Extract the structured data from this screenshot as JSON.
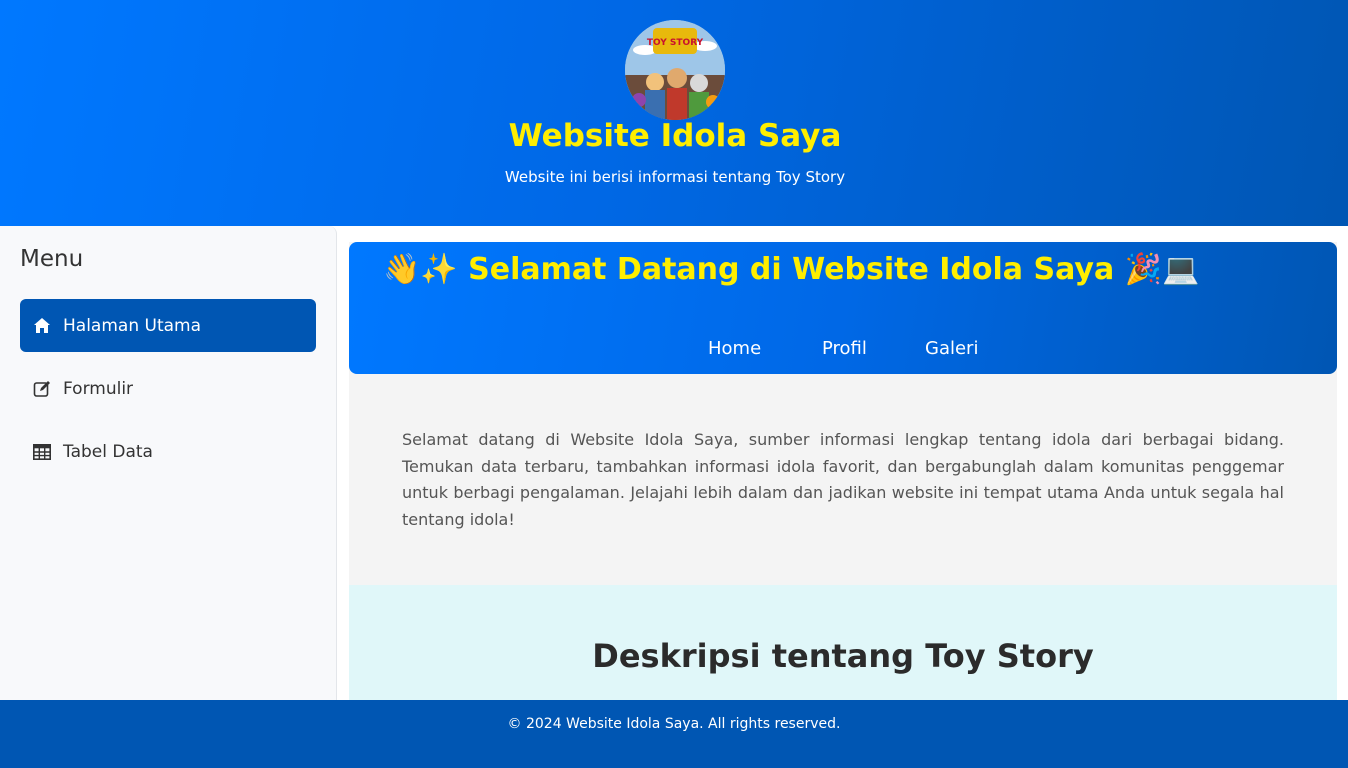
{
  "header": {
    "title": "Website Idola Saya",
    "subtitle": "Website ini berisi informasi tentang Toy Story",
    "avatar_icon": "toy-story-logo",
    "logo_text": "TOY STORY"
  },
  "sidebar": {
    "title": "Menu",
    "items": [
      {
        "label": "Halaman Utama",
        "icon": "home-icon",
        "active": true
      },
      {
        "label": "Formulir",
        "icon": "edit-icon",
        "active": false
      },
      {
        "label": "Tabel Data",
        "icon": "table-icon",
        "active": false
      }
    ]
  },
  "main": {
    "welcome_heading": "👋✨ Selamat Datang di Website Idola Saya 🎉💻",
    "nav": [
      {
        "label": "Home"
      },
      {
        "label": "Profil"
      },
      {
        "label": "Galeri"
      }
    ],
    "intro": "Selamat datang di Website Idola Saya, sumber informasi lengkap tentang idola dari berbagai bidang. Temukan data terbaru, tambahkan informasi idola favorit, dan bergabunglah dalam komunitas penggemar untuk berbagi pengalaman. Jelajahi lebih dalam dan jadikan website ini tempat utama Anda untuk segala hal tentang idola!",
    "description_title": "Deskripsi tentang Toy Story"
  },
  "footer": {
    "text": "© 2024 Website Idola Saya. All rights reserved."
  },
  "colors": {
    "primary": "#0056b3",
    "header_gradient_start": "#0078ff",
    "title_yellow": "#ffee00",
    "description_bg": "#e0f7f9"
  }
}
